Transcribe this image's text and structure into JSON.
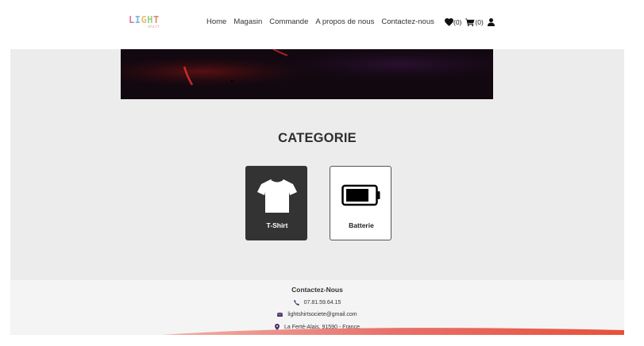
{
  "header": {
    "logo_text": "LIGHT",
    "logo_sub": "shirt",
    "nav": [
      {
        "label": "Home"
      },
      {
        "label": "Magasin"
      },
      {
        "label": "Commande"
      },
      {
        "label": "A propos de nous"
      },
      {
        "label": "Contactez-nous"
      }
    ],
    "wishlist_count": "(0)",
    "cart_count": "(0)"
  },
  "main": {
    "section_title": "CATEGORIE",
    "categories": [
      {
        "label": "T-Shirt",
        "icon": "tshirt-icon"
      },
      {
        "label": "Batterie",
        "icon": "battery-icon"
      }
    ]
  },
  "footer": {
    "title": "Contactez-Nous",
    "phone": "07.81.59.64.15",
    "email": "lightshirtsociete@gmail.com",
    "address": "La Ferté-Alais, 91590 - France"
  },
  "colors": {
    "accent": "#5a3a7a",
    "card_dark": "#333333",
    "background_grey": "#ececec"
  }
}
